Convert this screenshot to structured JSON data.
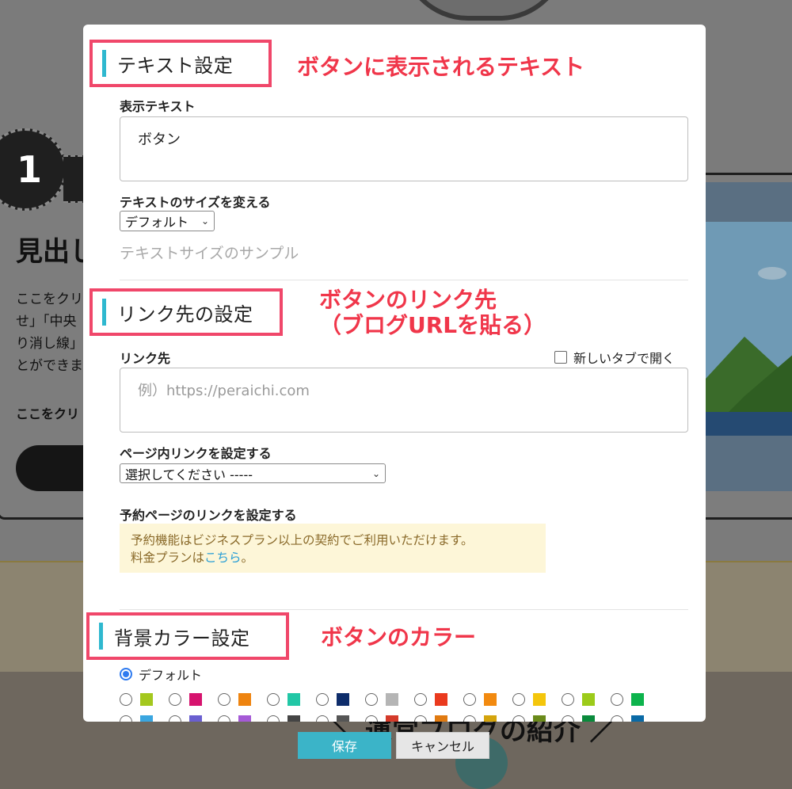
{
  "background": {
    "section_number": "1",
    "heading": "見出し",
    "paragraph": "ここをクリ\nせ」「中央\nり消し線」\nとができま",
    "bold_text": "ここをクリ",
    "bottom_title": "＼ 運営ブログの紹介 ／"
  },
  "modal": {
    "text_section": {
      "heading": "テキスト設定",
      "annotation": "ボタンに表示されるテキスト",
      "display_text_label": "表示テキスト",
      "display_text_value": "ボタン",
      "size_label": "テキストのサイズを変える",
      "size_select_value": "デフォルト",
      "sample_text": "テキストサイズのサンプル"
    },
    "link_section": {
      "heading": "リンク先の設定",
      "annotation": "ボタンのリンク先\n（ブログURLを貼る）",
      "link_label": "リンク先",
      "new_tab_label": "新しいタブで開く",
      "link_placeholder": "例）https://peraichi.com",
      "anchor_label": "ページ内リンクを設定する",
      "anchor_select_value": "選択してください -----",
      "reservation_label": "予約ページのリンクを設定する",
      "notice_line1": "予約機能はビジネスプラン以上の契約でご利用いただけます。",
      "notice_line2_prefix": "料金プランは",
      "notice_link": "こちら",
      "notice_line2_suffix": "。"
    },
    "color_section": {
      "heading": "背景カラー設定",
      "annotation": "ボタンのカラー",
      "default_label": "デフォルト",
      "swatch_row1": [
        "#a4c81e",
        "#d6136e",
        "#ee8410",
        "#22c7a6",
        "#0e2d6b",
        "#b5b5b5",
        "#ea3a1e",
        "#f28a10",
        "#f4c60c",
        "#9ccb1a",
        "#0db34c"
      ],
      "swatch_row2": [
        "#3aa6e0",
        "#6a5fd0",
        "#a55ad6",
        "#444444",
        "#555555",
        "#d43a2a",
        "#e07a10",
        "#d4a40c",
        "#6a8a1a",
        "#0a8a3c",
        "#0a6aa6"
      ]
    }
  },
  "footer": {
    "save_label": "保存",
    "cancel_label": "キャンセル"
  },
  "colors": {
    "accent": "#2fb8cf",
    "annotation_red": "#f0364a",
    "frame_pink": "#f0476a",
    "save_button": "#3bb4c8"
  }
}
